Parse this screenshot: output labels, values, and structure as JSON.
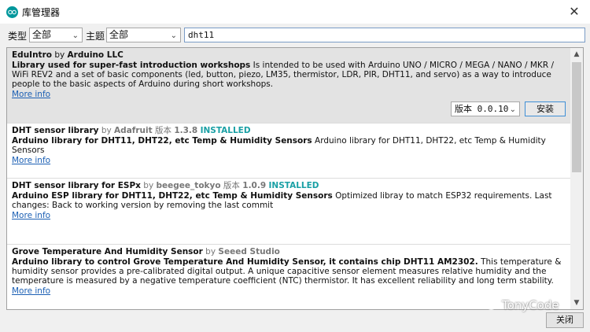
{
  "window": {
    "title": "库管理器",
    "close_glyph": "✕",
    "app_icon": "arduino-icon"
  },
  "filters": {
    "type_label": "类型",
    "type_value": "全部",
    "topic_label": "主题",
    "topic_value": "全部",
    "search_value": "dht11"
  },
  "libraries": [
    {
      "name": "EduIntro",
      "by": "by",
      "author": "Arduino LLC",
      "version_label": "",
      "version": "",
      "installed": "",
      "summary": "Library used for super-fast introduction workshops",
      "description": " Is intended to be used with Arduino UNO / MICRO / MEGA / NANO / MKR / WiFi REV2 and a set of basic components (led, button, piezo, LM35, thermistor, LDR, PIR, DHT11, and servo) as a way to introduce people to the basic aspects of Arduino during short workshops.",
      "more_info": "More info"
    },
    {
      "name": "DHT sensor library",
      "by": "by",
      "author": "Adafruit",
      "version_label": "版本",
      "version": "1.3.8",
      "installed": "INSTALLED",
      "summary": "Arduino library for DHT11, DHT22, etc Temp & Humidity Sensors",
      "description": " Arduino library for DHT11, DHT22, etc Temp & Humidity Sensors",
      "more_info": "More info"
    },
    {
      "name": "DHT sensor library for ESPx",
      "by": "by",
      "author": "beegee_tokyo",
      "version_label": "版本",
      "version": "1.0.9",
      "installed": "INSTALLED",
      "summary": "Arduino ESP library for DHT11, DHT22, etc Temp & Humidity Sensors",
      "description": " Optimized libray to match ESP32 requirements. Last changes: Back to working version by removing the last commit",
      "more_info": "More info"
    },
    {
      "name": "Grove Temperature And Humidity Sensor",
      "by": "by",
      "author": "Seeed Studio",
      "version_label": "",
      "version": "",
      "installed": "",
      "summary": "Arduino library to control Grove Temperature And Humidity Sensor, it contains chip DHT11 AM2302.",
      "description": " This temperature & humidity sensor provides a pre-calibrated digital output. A unique capacitive sensor element measures relative humidity and the temperature is measured by a negative temperature coefficient (NTC) thermistor. It has excellent reliability and long term stability.",
      "more_info": "More info"
    }
  ],
  "selected_item": {
    "version_select": "版本 0.0.10",
    "install_label": "安装"
  },
  "scrollbar": {
    "up": "▲",
    "down": "▼"
  },
  "watermark": {
    "text": "TonyCode"
  },
  "footer": {
    "close_label": "关闭"
  },
  "colors": {
    "accent_installed": "#1aa0a5",
    "link": "#1b5fb4",
    "selected_bg": "#e3e3e3",
    "arduino_teal": "#00979c"
  }
}
